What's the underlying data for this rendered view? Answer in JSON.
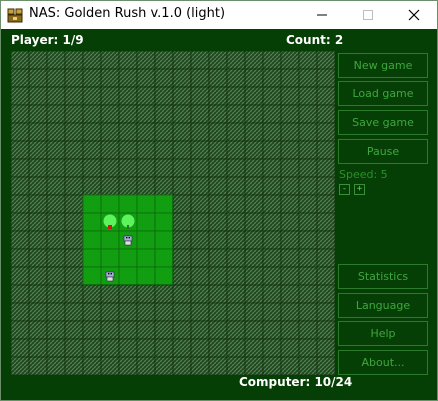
{
  "window": {
    "title": "NAS: Golden Rush v.1.0 (light)",
    "icon": "chest-icon",
    "controls": [
      "minimize-icon",
      "maximize-icon",
      "close-icon"
    ]
  },
  "hud": {
    "player": "Player: 1/9",
    "count": "Count: 2",
    "computer": "Computer: 10/24"
  },
  "board": {
    "grid_size": 18,
    "revealed": {
      "col_start": 4,
      "col_end": 8,
      "row_start": 8,
      "row_end": 12
    },
    "trees": [
      {
        "col": 5,
        "row": 9
      },
      {
        "col": 6,
        "row": 9
      }
    ],
    "marker": {
      "col": 5,
      "row": 9
    },
    "robots": [
      {
        "col": 6,
        "row": 10
      },
      {
        "col": 5,
        "row": 12
      }
    ],
    "colors": {
      "hidden_cell": "#1c4a1c",
      "hidden_hatch": "#6b8f6b",
      "revealed_cell": "#119f11",
      "revealed_line": "#0a6b0a",
      "tree": "#5cf35c",
      "marker": "#d01818",
      "robot": "#a8b2d8"
    }
  },
  "sidebar": {
    "new_game": "New game",
    "load_game": "Load game",
    "save_game": "Save game",
    "pause": "Pause",
    "speed_label": "Speed: 5",
    "speed_minus": "-",
    "speed_plus": "+",
    "statistics": "Statistics",
    "language": "Language",
    "help": "Help",
    "about": "About..."
  }
}
